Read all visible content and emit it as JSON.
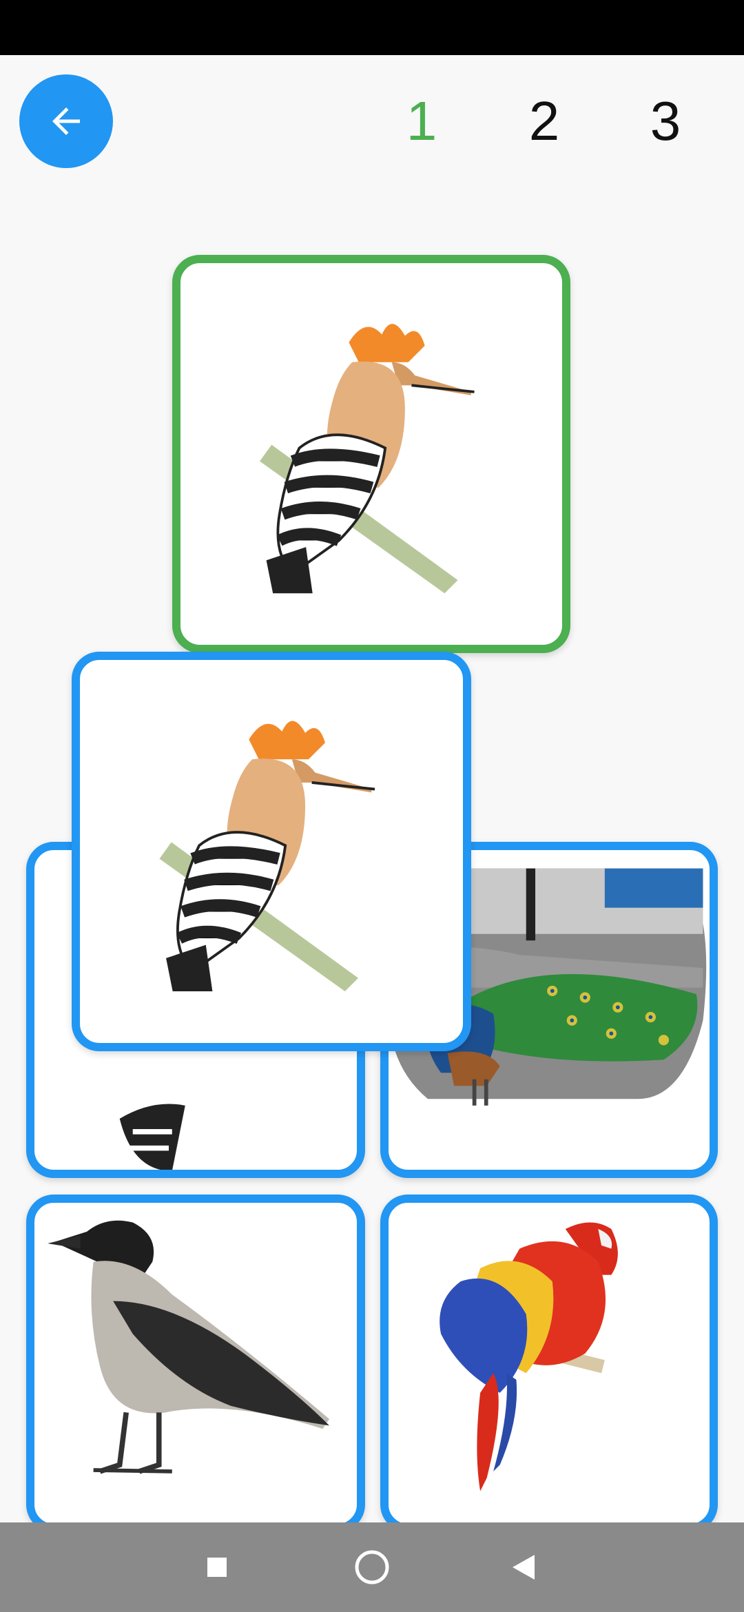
{
  "header": {
    "back_icon": "arrow-left-icon",
    "steps": [
      {
        "label": "1",
        "state": "active"
      },
      {
        "label": "2",
        "state": "idle"
      },
      {
        "label": "3",
        "state": "idle"
      }
    ]
  },
  "target_card": {
    "image": "hoopoe-bird-image",
    "border": "#4caf50"
  },
  "dragged_card": {
    "image": "hoopoe-bird-image",
    "border": "#2196f3"
  },
  "grid_cards": [
    {
      "image": "hoopoe-bird-image"
    },
    {
      "image": "peacock-image"
    },
    {
      "image": "hooded-crow-image"
    },
    {
      "image": "scarlet-macaw-image"
    }
  ],
  "colors": {
    "accent": "#2196f3",
    "correct": "#4caf50",
    "nav_bar": "#8a8a8a"
  },
  "nav": {
    "icons": [
      "square-recents-icon",
      "circle-home-icon",
      "triangle-back-icon"
    ]
  }
}
